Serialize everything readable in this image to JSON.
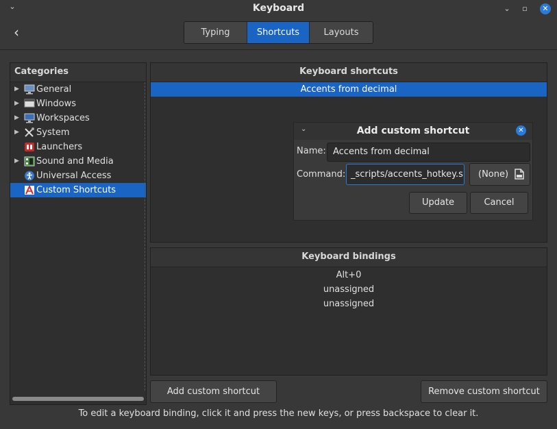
{
  "window": {
    "title": "Keyboard",
    "menu_glyph": "⌄",
    "minimize_glyph": "⌄",
    "maximize_glyph": "▫",
    "close_glyph": "✕"
  },
  "header": {
    "back_glyph": "‹",
    "tabs": [
      {
        "label": "Typing"
      },
      {
        "label": "Shortcuts"
      },
      {
        "label": "Layouts"
      }
    ]
  },
  "categories": {
    "heading": "Categories",
    "items": [
      {
        "label": "General",
        "icon": "monitor-icon"
      },
      {
        "label": "Windows",
        "icon": "windows-icon"
      },
      {
        "label": "Workspaces",
        "icon": "workspaces-icon"
      },
      {
        "label": "System",
        "icon": "tools-icon"
      },
      {
        "label": "Launchers",
        "icon": "launchers-icon"
      },
      {
        "label": "Sound and Media",
        "icon": "media-icon"
      },
      {
        "label": "Universal Access",
        "icon": "accessibility-icon"
      },
      {
        "label": "Custom Shortcuts",
        "icon": "custom-shortcuts-icon"
      }
    ],
    "arrow_glyph": "▶"
  },
  "shortcuts": {
    "heading": "Keyboard shortcuts",
    "rows": [
      "Accents from decimal"
    ]
  },
  "dialog": {
    "title": "Add custom shortcut",
    "menu_glyph": "⌄",
    "close_glyph": "✕",
    "name_label": "Name:",
    "name_value": "Accents from decimal",
    "command_label": "Command:",
    "command_value": "scripts/accents_hotkey.sh",
    "command_prefix": "_",
    "file_button_label": "(None)",
    "update_label": "Update",
    "cancel_label": "Cancel"
  },
  "bindings": {
    "heading": "Keyboard bindings",
    "rows": [
      "Alt+0",
      "unassigned",
      "unassigned"
    ]
  },
  "actions": {
    "add_label": "Add custom shortcut",
    "remove_label": "Remove custom shortcut"
  },
  "footer": {
    "hint": "To edit a keyboard binding, click it and press the new keys, or press backspace to clear it."
  },
  "colors": {
    "accent": "#1a64c4",
    "background": "#383838",
    "panel": "#2f2f2f"
  }
}
